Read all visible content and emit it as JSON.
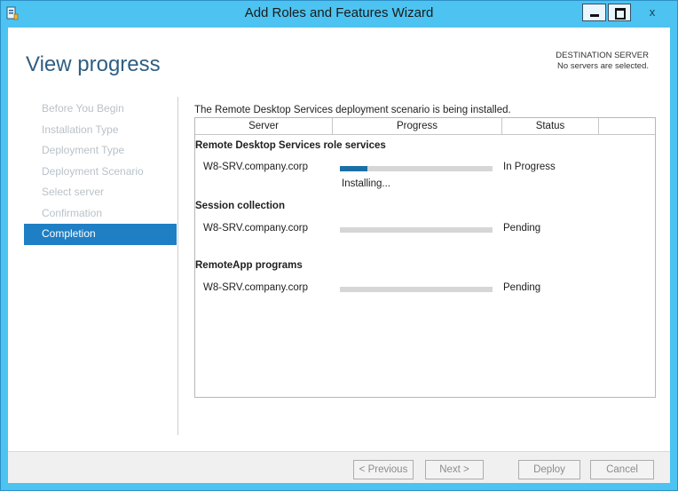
{
  "window": {
    "title": "Add Roles and Features Wizard",
    "close_glyph": "x"
  },
  "page": {
    "title": "View progress"
  },
  "destination": {
    "label": "DESTINATION SERVER",
    "value": "No servers are selected."
  },
  "nav": [
    {
      "label": "Before You Begin",
      "active": false
    },
    {
      "label": "Installation Type",
      "active": false
    },
    {
      "label": "Deployment Type",
      "active": false
    },
    {
      "label": "Deployment Scenario",
      "active": false
    },
    {
      "label": "Select server",
      "active": false
    },
    {
      "label": "Confirmation",
      "active": false
    },
    {
      "label": "Completion",
      "active": true
    }
  ],
  "status_message": "The Remote Desktop Services deployment scenario is being installed.",
  "grid": {
    "columns": [
      "Server",
      "Progress",
      "Status"
    ],
    "sections": [
      {
        "title": "Remote Desktop Services role services",
        "server": "W8-SRV.company.corp",
        "progress": 0.18,
        "status": "In Progress",
        "sub_status": "Installing..."
      },
      {
        "title": "Session collection",
        "server": "W8-SRV.company.corp",
        "progress": 0,
        "status": "Pending",
        "sub_status": ""
      },
      {
        "title": "RemoteApp programs",
        "server": "W8-SRV.company.corp",
        "progress": 0,
        "status": "Pending",
        "sub_status": ""
      }
    ]
  },
  "buttons": {
    "previous": "< Previous",
    "next": "Next >",
    "deploy": "Deploy",
    "cancel": "Cancel"
  },
  "colors": {
    "accent": "#1f7fc4",
    "titlebar": "#4cc3f1",
    "progress_fill": "#1b6fa8",
    "progress_track": "#d6d6d6"
  }
}
